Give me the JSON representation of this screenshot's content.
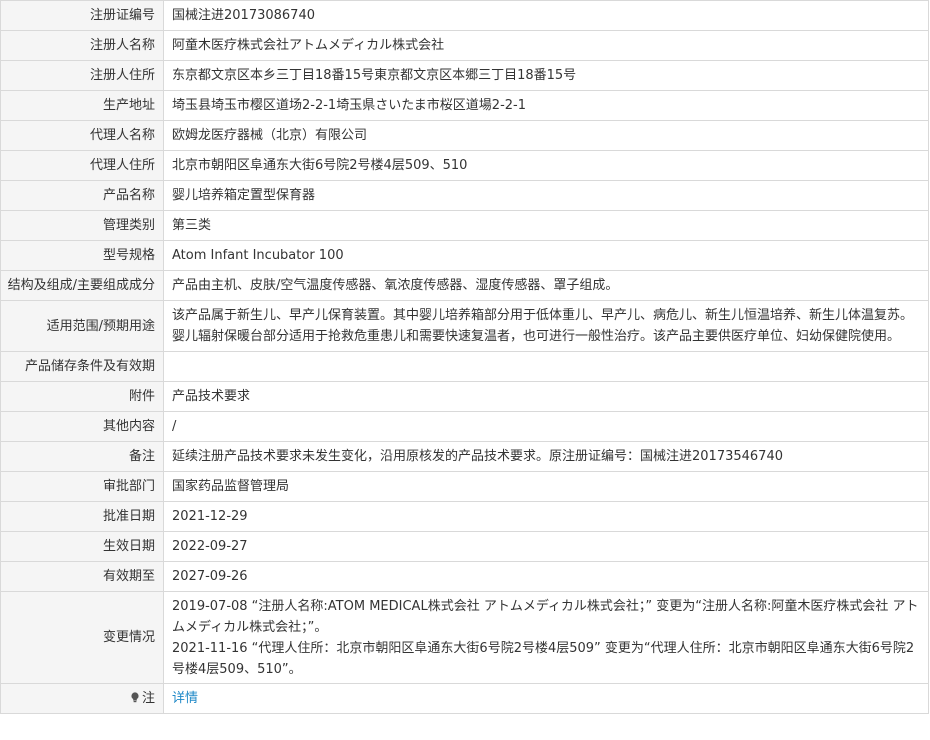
{
  "rows": [
    {
      "label": "注册证编号",
      "value": "国械注进20173086740"
    },
    {
      "label": "注册人名称",
      "value": "阿童木医疗株式会社アトムメディカル株式会社"
    },
    {
      "label": "注册人住所",
      "value": "东京都文京区本乡三丁目18番15号東京都文京区本郷三丁目18番15号"
    },
    {
      "label": "生产地址",
      "value": "埼玉县埼玉市樱区道场2-2-1埼玉県さいたま市桜区道場2-2-1"
    },
    {
      "label": "代理人名称",
      "value": "欧姆龙医疗器械（北京）有限公司"
    },
    {
      "label": "代理人住所",
      "value": "北京市朝阳区阜通东大街6号院2号楼4层509、510"
    },
    {
      "label": "产品名称",
      "value": "婴儿培养箱定置型保育器"
    },
    {
      "label": "管理类别",
      "value": "第三类"
    },
    {
      "label": "型号规格",
      "value": "Atom Infant Incubator 100"
    },
    {
      "label": "结构及组成/主要组成成分",
      "value": "产品由主机、皮肤/空气温度传感器、氧浓度传感器、湿度传感器、罩子组成。"
    },
    {
      "label": "适用范围/预期用途",
      "value": "该产品属于新生儿、早产儿保育装置。其中婴儿培养箱部分用于低体重儿、早产儿、病危儿、新生儿恒温培养、新生儿体温复苏。婴儿辐射保暖台部分适用于抢救危重患儿和需要快速复温者，也可进行一般性治疗。该产品主要供医疗单位、妇幼保健院使用。"
    },
    {
      "label": "产品储存条件及有效期",
      "value": ""
    },
    {
      "label": "附件",
      "value": "产品技术要求"
    },
    {
      "label": "其他内容",
      "value": "/"
    },
    {
      "label": "备注",
      "value": "延续注册产品技术要求未发生变化，沿用原核发的产品技术要求。原注册证编号：国械注进20173546740"
    },
    {
      "label": "审批部门",
      "value": "国家药品监督管理局"
    },
    {
      "label": "批准日期",
      "value": "2021-12-29"
    },
    {
      "label": "生效日期",
      "value": "2022-09-27"
    },
    {
      "label": "有效期至",
      "value": "2027-09-26"
    },
    {
      "label": "变更情况",
      "value_lines": [
        "2019-07-08 “注册人名称:ATOM MEDICAL株式会社 アトムメディカル株式会社；” 变更为“注册人名称:阿童木医疗株式会社 アトムメディカル株式会社；”。",
        "2021-11-16 “代理人住所：北京市朝阳区阜通东大街6号院2号楼4层509” 变更为“代理人住所：北京市朝阳区阜通东大街6号院2号楼4层509、510”。"
      ]
    },
    {
      "label": "注",
      "value": "详情",
      "icon": "lightbulb-icon"
    }
  ],
  "colors": {
    "label_bg": "#f5f5f5",
    "border": "#d9d9d9",
    "text": "#333333",
    "link": "#1e88c7"
  }
}
